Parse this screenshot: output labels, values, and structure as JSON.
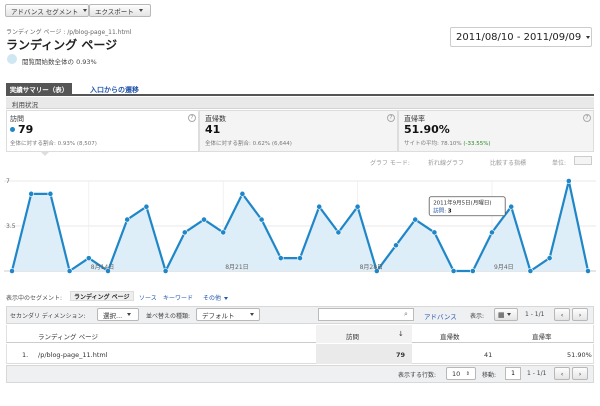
{
  "toolbar": {
    "advanced_segments": "アドバンス セグメント",
    "export": "エクスポート"
  },
  "header": {
    "breadcrumb": "ランディング ページ : /p/blog-page_11.html",
    "title": "ランディング ページ",
    "date_range": "2011/08/10 - 2011/09/09",
    "share_text": "閲覧開始数全体の 0.93%"
  },
  "tabs": [
    {
      "label": "実績サマリー（表）"
    },
    {
      "label": "入口からの遷移"
    }
  ],
  "usage_label": "利用状況",
  "metrics": [
    {
      "label": "訪問",
      "value": "79",
      "sub": "全体に対する割合: 0.93% (8,507)"
    },
    {
      "label": "直帰数",
      "value": "41",
      "sub": "全体に対する割合: 0.62% (6,644)"
    },
    {
      "label": "直帰率",
      "value": "51.90%",
      "sub": "サイトの平均: 78.10%",
      "delta": "(-33.55%)"
    }
  ],
  "graph_controls": {
    "graph_mode": "グラフ モード:",
    "line_graph": "折れ線グラフ",
    "compare": "比較する指標",
    "unit": "単位:"
  },
  "chart_data": {
    "type": "area",
    "y_ticks": [
      "7",
      "3.5"
    ],
    "ylim": [
      0,
      7
    ],
    "x_tick_labels": [
      "8月14日",
      "8月21日",
      "8月28日",
      "9月4日"
    ],
    "x": [
      "8/10",
      "8/11",
      "8/12",
      "8/13",
      "8/14",
      "8/15",
      "8/16",
      "8/17",
      "8/18",
      "8/19",
      "8/20",
      "8/21",
      "8/22",
      "8/23",
      "8/24",
      "8/25",
      "8/26",
      "8/27",
      "8/28",
      "8/29",
      "8/30",
      "8/31",
      "9/1",
      "9/2",
      "9/3",
      "9/4",
      "9/5",
      "9/6",
      "9/7",
      "9/8",
      "9/9"
    ],
    "values": [
      0,
      6,
      6,
      0,
      1,
      0,
      4,
      5,
      0,
      3,
      4,
      3,
      6,
      4,
      1,
      1,
      5,
      3,
      5,
      0,
      2,
      4,
      3,
      0,
      0,
      3,
      5,
      0,
      1,
      7,
      0
    ],
    "color": "#1f86c8",
    "fill": "#ddeef8",
    "tooltip": {
      "date": "2011年9月5日(月曜日)",
      "label": "訪問:",
      "value": "3"
    }
  },
  "segment_row": {
    "label": "表示中のセグメント:",
    "active": "ランディング ページ",
    "links": [
      "ソース",
      "キーワード",
      "その他"
    ]
  },
  "table_controls": {
    "secondary_dimension": "セカンダリ ディメンション:",
    "select_label": "選択...",
    "sort_type_label": "並べ替えの種類:",
    "sort_default": "デフォルト",
    "search_placeholder": "",
    "advanced_link": "アドバンス",
    "display_label": "表示:",
    "pagination": "1 - 1/1"
  },
  "table": {
    "columns": [
      "ランディング ページ",
      "訪問",
      "直帰数",
      "直帰率"
    ],
    "rows": [
      {
        "index": "1.",
        "page": "/p/blog-page_11.html",
        "visits": "79",
        "bounces": "41",
        "bounce_rate": "51.90%"
      }
    ]
  },
  "footer": {
    "rows_label": "表示する行数:",
    "rows_value": "10",
    "goto_label": "移動:",
    "goto_value": "1",
    "pagination": "1 - 1/1"
  }
}
